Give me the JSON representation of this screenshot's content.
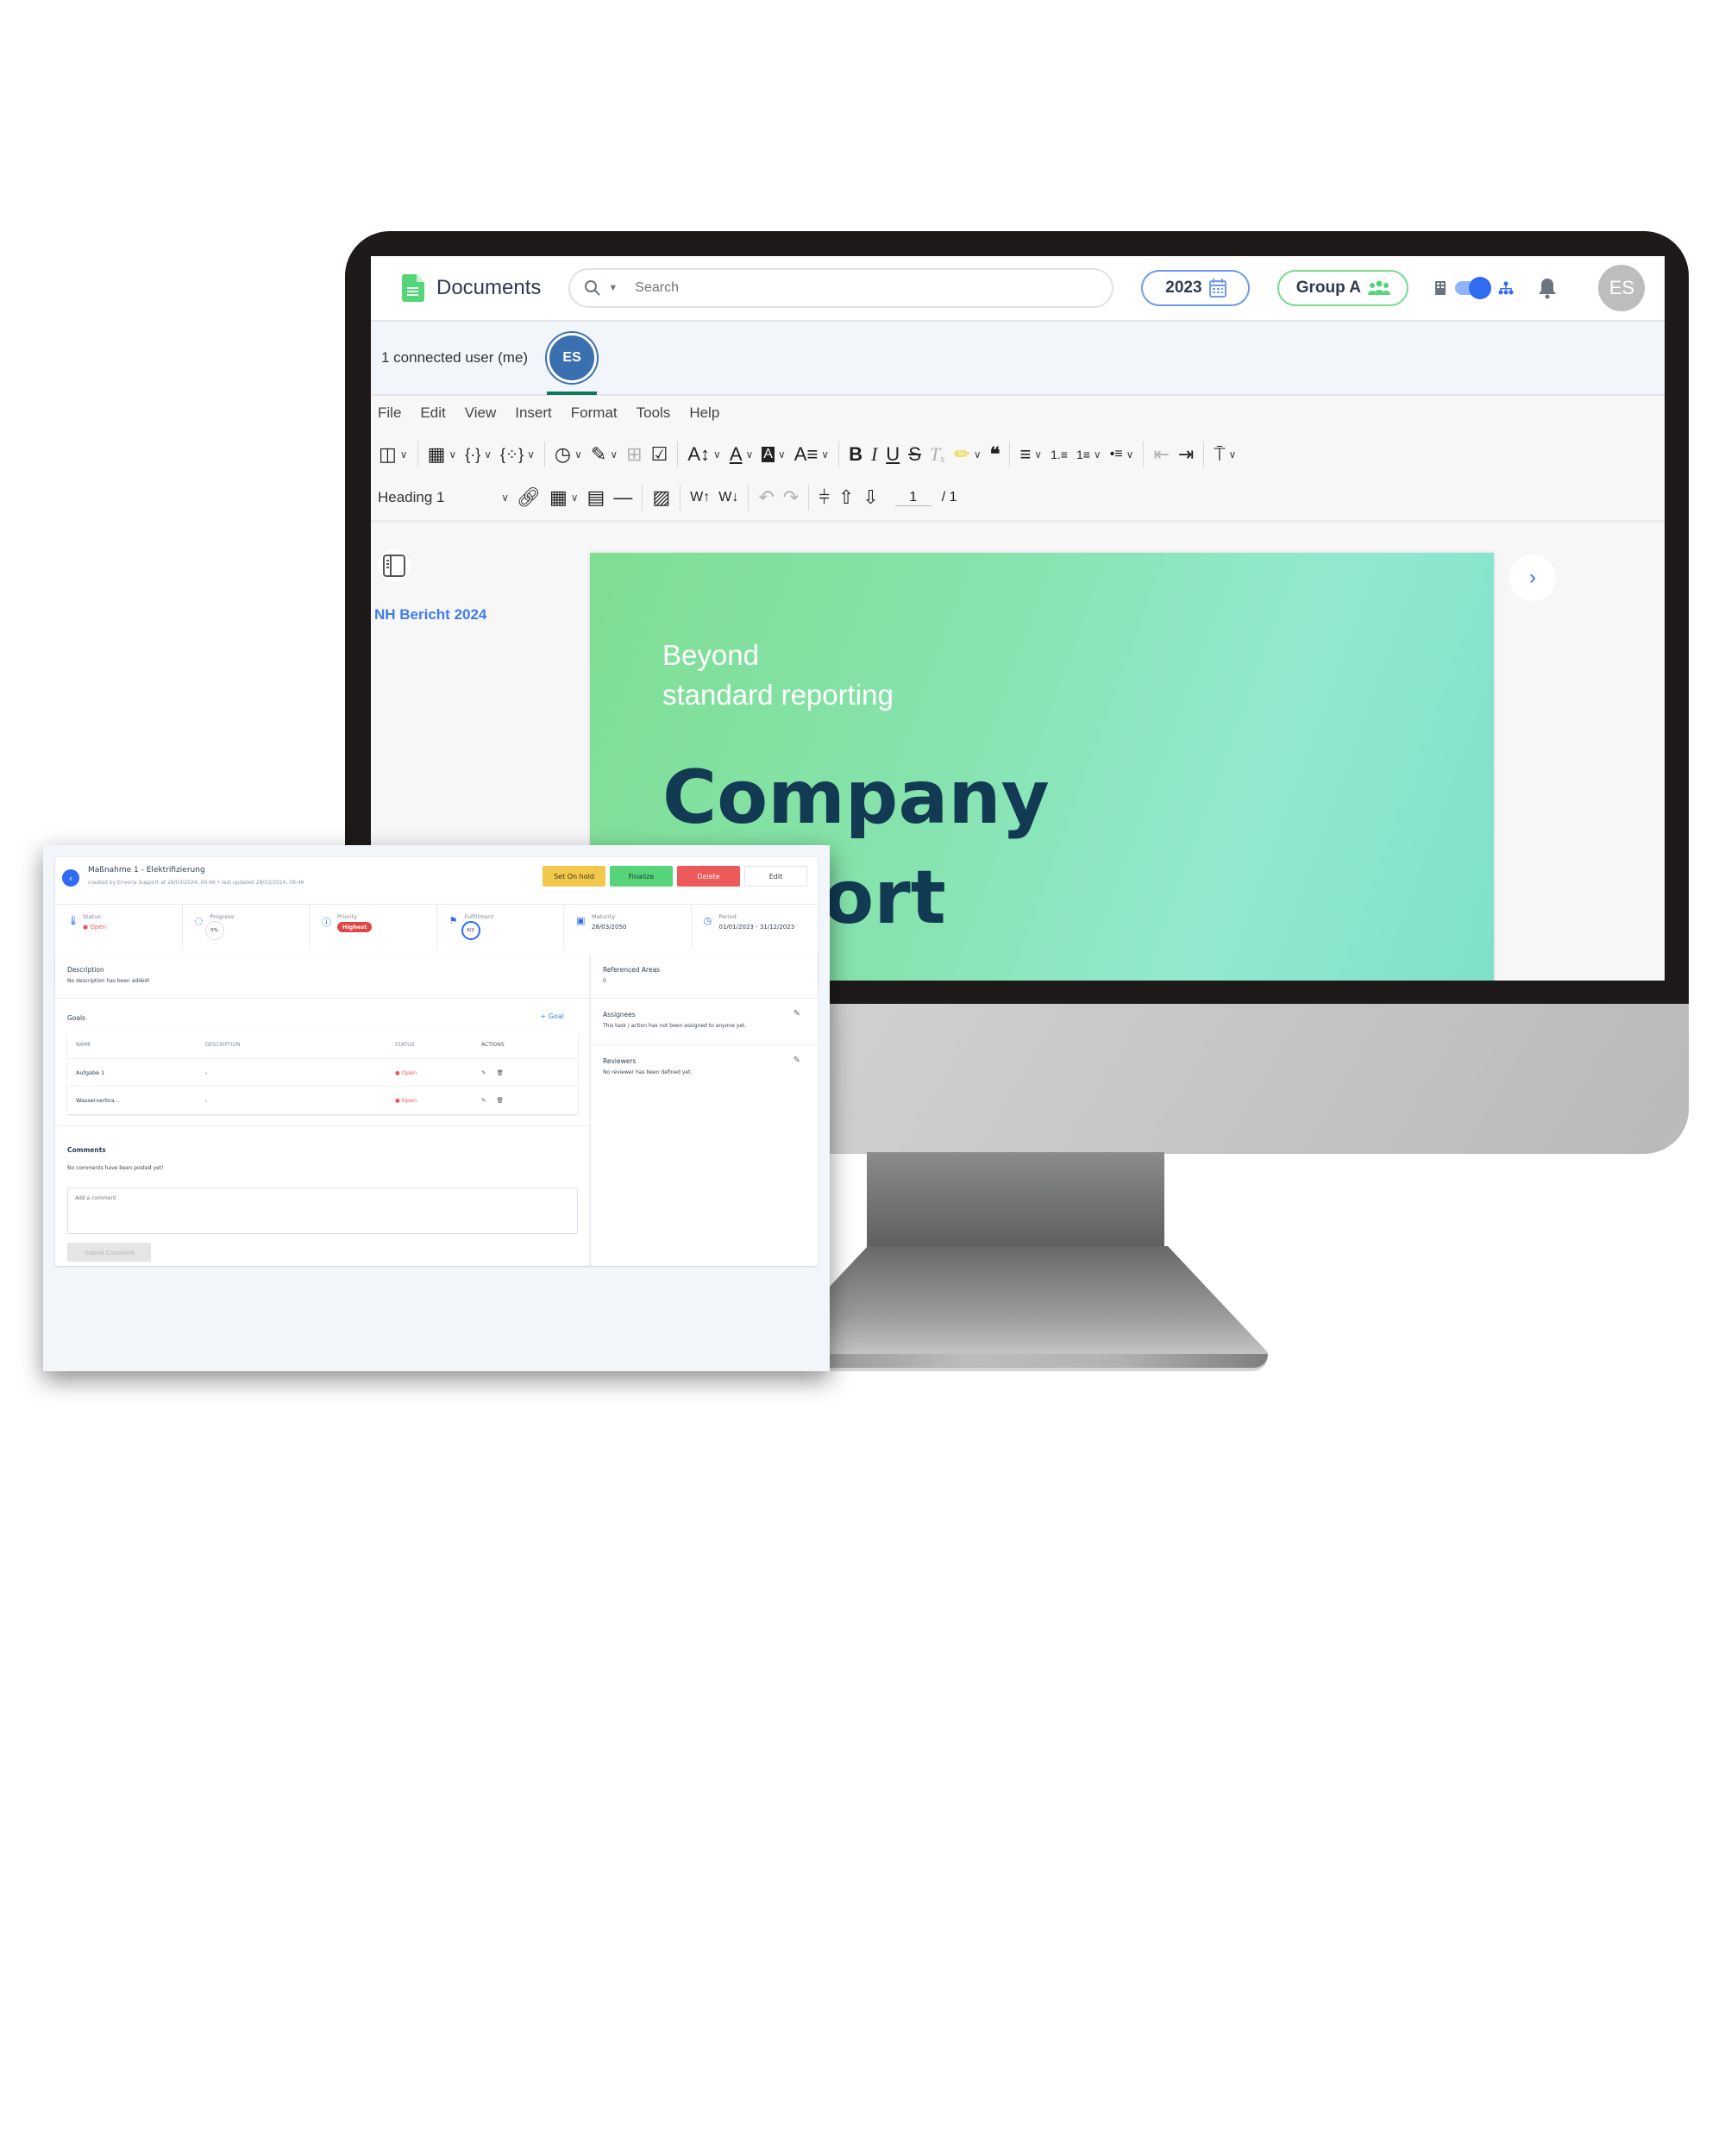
{
  "app": {
    "name": "Documents",
    "search_placeholder": "Search",
    "year": "2023",
    "group": "Group A",
    "user_initials": "ES",
    "accent": "#2f6cf0",
    "brand_green": "#56d47a"
  },
  "collab": {
    "connected_text": "1 connected user (me)",
    "avatar_initials": "ES"
  },
  "menu": [
    "File",
    "Edit",
    "View",
    "Insert",
    "Format",
    "Tools",
    "Help"
  ],
  "toolbar": {
    "style_select": "Heading 1",
    "page_current": "1",
    "page_total": "/ 1"
  },
  "document": {
    "title": "NH Bericht 2024",
    "tagline_line1": "Beyond",
    "tagline_line2": "standard reporting",
    "headline_line1": "Company",
    "headline_line2": "Report"
  },
  "task": {
    "title": "Maßnahme 1 - Elektrifizierung",
    "meta": "created by Envoria Support at 28/03/2024, 09:46 • last updated 28/03/2024, 09:46",
    "buttons": {
      "hold": "Set On hold",
      "finalize": "Finalize",
      "delete": "Delete",
      "edit": "Edit"
    },
    "stats": {
      "status_label": "Status",
      "status_value": "● Open",
      "progress_label": "Progress",
      "progress_value": "0%",
      "priority_label": "Priority",
      "priority_value": "Highest",
      "fulfillment_label": "Fulfillment",
      "fulfillment_value": "0/2",
      "maturity_label": "Maturity",
      "maturity_value": "28/03/2050",
      "period_label": "Period",
      "period_value": "01/01/2023 - 31/12/2023"
    },
    "description": {
      "title": "Description",
      "text": "No description has been added!"
    },
    "goals": {
      "title": "Goals",
      "add_label": "+ Goal",
      "columns": [
        "NAME",
        "DESCRIPTION",
        "STATUS",
        "ACTIONS"
      ],
      "rows": [
        {
          "name": "Aufgabe 1",
          "description": "-",
          "status": "● Open"
        },
        {
          "name": "Wasserverbra...",
          "description": "-",
          "status": "● Open"
        }
      ]
    },
    "comments": {
      "title": "Comments",
      "empty_text": "No comments have been posted yet!",
      "placeholder": "Add a comment",
      "submit_label": "Submit Comment"
    },
    "side": {
      "referenced_title": "Referenced Areas",
      "referenced_value": "0",
      "assignees_title": "Assignees",
      "assignees_text": "This task / action has not been assigned to anyone yet.",
      "reviewers_title": "Reviewers",
      "reviewers_text": "No reviewer has been defined yet."
    }
  }
}
